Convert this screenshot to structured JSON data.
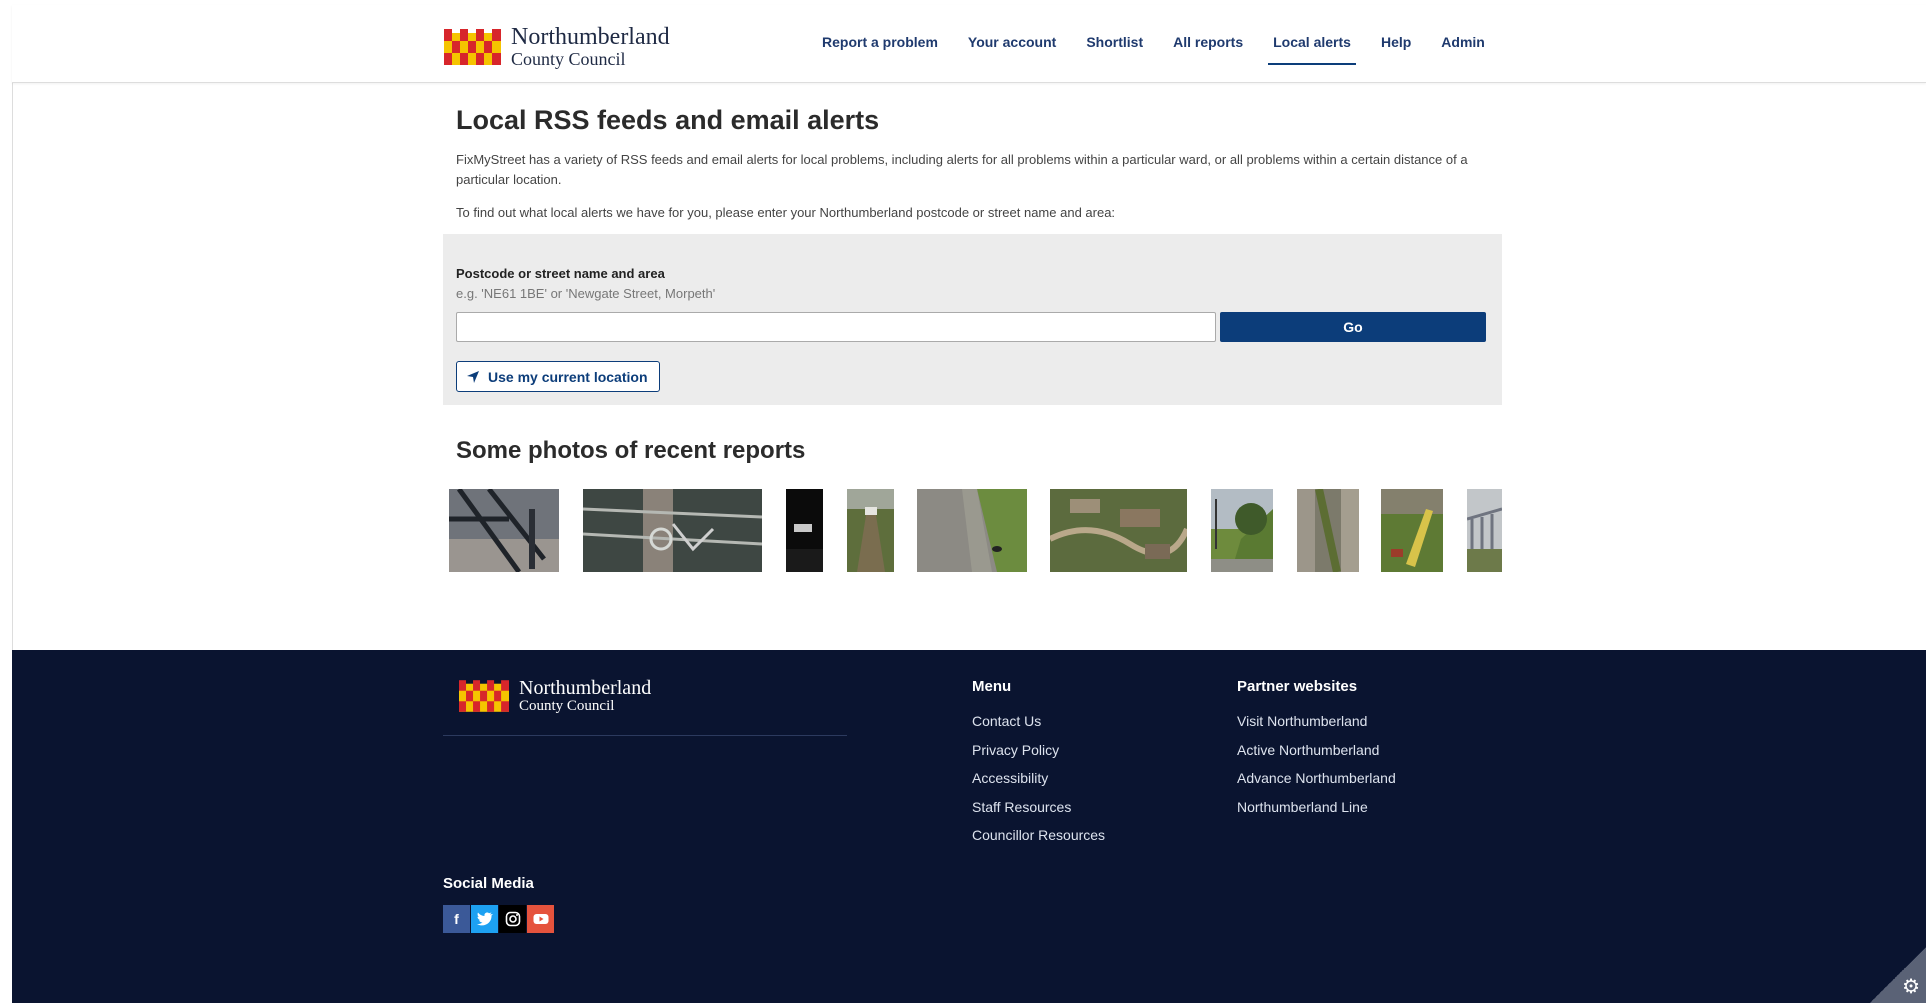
{
  "header": {
    "logo": {
      "line1": "Northumberland",
      "line2": "County Council"
    },
    "nav": [
      {
        "label": "Report a problem"
      },
      {
        "label": "Your account"
      },
      {
        "label": "Shortlist"
      },
      {
        "label": "All reports"
      },
      {
        "label": "Local alerts",
        "active": true
      },
      {
        "label": "Help"
      },
      {
        "label": "Admin"
      }
    ]
  },
  "main": {
    "title": "Local RSS feeds and email alerts",
    "intro": "FixMyStreet has a variety of RSS feeds and email alerts for local problems, including alerts for all problems within a particular ward, or all problems within a certain distance of a particular location.",
    "instruction": "To find out what local alerts we have for you, please enter your Northumberland postcode or street name and area:",
    "search": {
      "label": "Postcode or street name and area",
      "hint": "e.g. 'NE61 1BE' or 'Newgate Street, Morpeth'",
      "value": "",
      "go_label": "Go",
      "location_label": "Use my current location"
    },
    "photos_title": "Some photos of recent reports"
  },
  "footer": {
    "logo": {
      "line1": "Northumberland",
      "line2": "County Council"
    },
    "menu": {
      "title": "Menu",
      "items": [
        "Contact Us",
        "Privacy Policy",
        "Accessibility",
        "Staff Resources",
        "Councillor Resources"
      ]
    },
    "partners": {
      "title": "Partner websites",
      "items": [
        "Visit Northumberland",
        "Active Northumberland",
        "Advance Northumberland",
        "Northumberland Line"
      ]
    },
    "social_title": "Social Media",
    "social": [
      {
        "icon": "facebook-icon",
        "glyph": "f",
        "color": "#3b5998"
      },
      {
        "icon": "twitter-icon",
        "glyph": "t",
        "color": "#1da1f2"
      },
      {
        "icon": "instagram-icon",
        "glyph": "◎",
        "color": "#000000"
      },
      {
        "icon": "youtube-icon",
        "glyph": "▶",
        "color": "#e5533d"
      }
    ]
  },
  "colors": {
    "brand": "#0c3d7a",
    "footer_bg": "#0a1430",
    "flag_red": "#d7262b",
    "flag_yellow": "#f5c400"
  }
}
